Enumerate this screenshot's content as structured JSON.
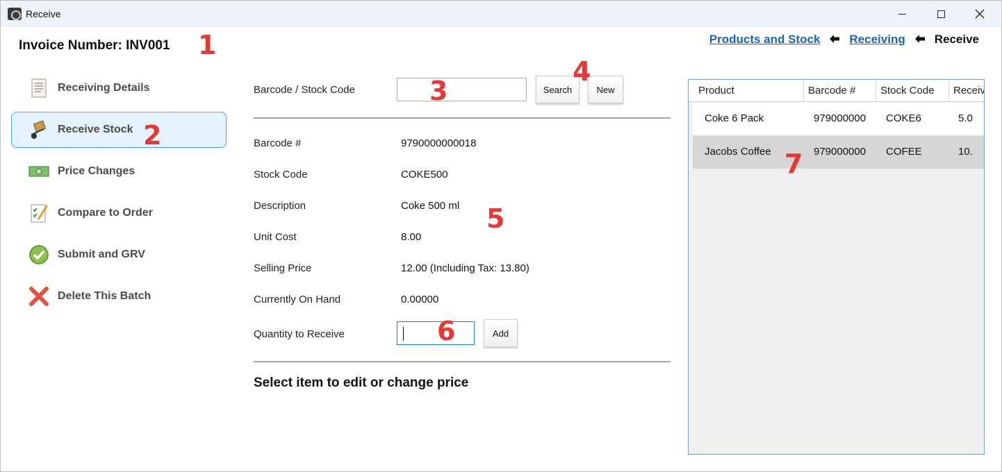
{
  "window": {
    "title": "Receive"
  },
  "invoice": {
    "label": "Invoice Number: INV001"
  },
  "breadcrumb": {
    "items": [
      {
        "label": "Products and Stock"
      },
      {
        "label": "Receiving"
      },
      {
        "label": "Receive"
      }
    ],
    "separator": "🡸"
  },
  "sidebar": {
    "items": [
      {
        "label": "Receiving Details",
        "icon": "document-icon"
      },
      {
        "label": "Receive Stock",
        "icon": "hand-truck-icon",
        "active": true
      },
      {
        "label": "Price Changes",
        "icon": "money-icon"
      },
      {
        "label": "Compare to Order",
        "icon": "checklist-icon"
      },
      {
        "label": "Submit and GRV",
        "icon": "check-circle-icon"
      },
      {
        "label": "Delete This Batch",
        "icon": "red-x-icon"
      }
    ]
  },
  "search": {
    "label": "Barcode / Stock Code",
    "value": "",
    "search_button": "Search",
    "new_button": "New"
  },
  "details": {
    "barcode_label": "Barcode #",
    "barcode_value": "9790000000018",
    "stock_code_label": "Stock Code",
    "stock_code_value": "COKE500",
    "description_label": "Description",
    "description_value": "Coke 500 ml",
    "unit_cost_label": "Unit Cost",
    "unit_cost_value": "8.00",
    "selling_price_label": "Selling Price",
    "selling_price_value": "12.00 (Including Tax: 13.80)",
    "on_hand_label": "Currently On Hand",
    "on_hand_value": "0.00000",
    "quantity_label": "Quantity to Receive",
    "quantity_value": "",
    "add_button": "Add"
  },
  "prompt": "Select item to edit or change price",
  "grid": {
    "columns": [
      "Product",
      "Barcode #",
      "Stock Code",
      "Receiv"
    ],
    "rows": [
      [
        "Coke 6 Pack",
        "979000000",
        "COKE6",
        "5.0"
      ],
      [
        "Jacobs Coffee",
        "979000000",
        "COFEE",
        "10."
      ]
    ]
  },
  "annotations": [
    "1",
    "2",
    "3",
    "4",
    "5",
    "6",
    "7"
  ],
  "colors": {
    "accent": "#1565c0",
    "annotation": "#e53935",
    "active_bg": "#e3f2fd",
    "active_border": "#42a5f5"
  }
}
